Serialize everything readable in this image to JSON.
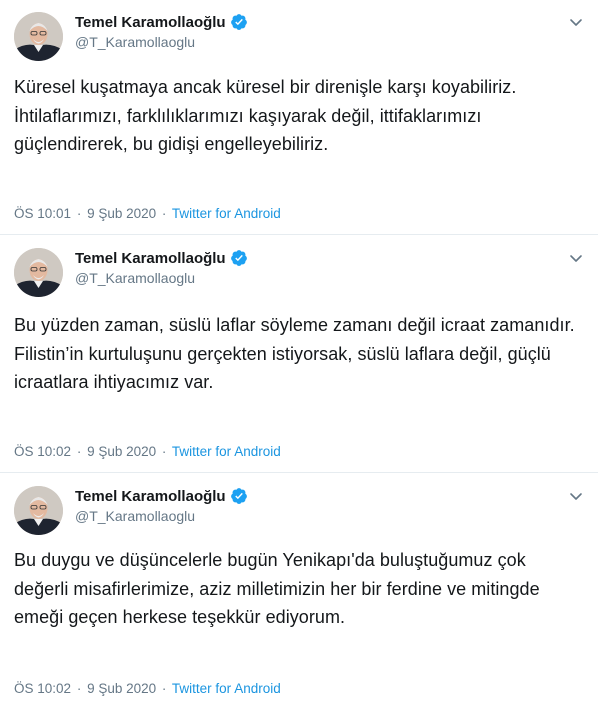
{
  "author": {
    "display_name": "Temel Karamollaoğlu",
    "handle": "@T_Karamollaoglu",
    "verified_icon": "verified-badge-icon"
  },
  "colors": {
    "link": "#1b95e0",
    "muted": "#657786",
    "text": "#14171a",
    "separator": "#e6ecf0"
  },
  "tweets": [
    {
      "text": "Küresel kuşatmaya ancak küresel bir direnişle karşı koyabiliriz.\nİhtilaflarımızı, farklılıklarımızı kaşıyarak değil, ittifaklarımızı güçlendirerek, bu gidişi engelleyebiliriz.",
      "time": "ÖS 10:01",
      "date": "9 Şub 2020",
      "separator": "·",
      "source": "Twitter for Android"
    },
    {
      "text": "Bu yüzden zaman, süslü laflar söyleme zamanı değil icraat zamanıdır. Filistin’in kurtuluşunu gerçekten istiyorsak, süslü laflara değil, güçlü icraatlara ihtiyacımız var.",
      "time": "ÖS 10:02",
      "date": "9 Şub 2020",
      "separator": "·",
      "source": "Twitter for Android"
    },
    {
      "text": "Bu duygu ve düşüncelerle bugün Yenikapı'da buluştuğumuz çok değerli misafirlerimize, aziz milletimizin her bir ferdine ve mitingde emeği geçen herkese teşekkür ediyorum.",
      "time": "ÖS 10:02",
      "date": "9 Şub 2020",
      "separator": "·",
      "source": "Twitter for Android"
    }
  ]
}
